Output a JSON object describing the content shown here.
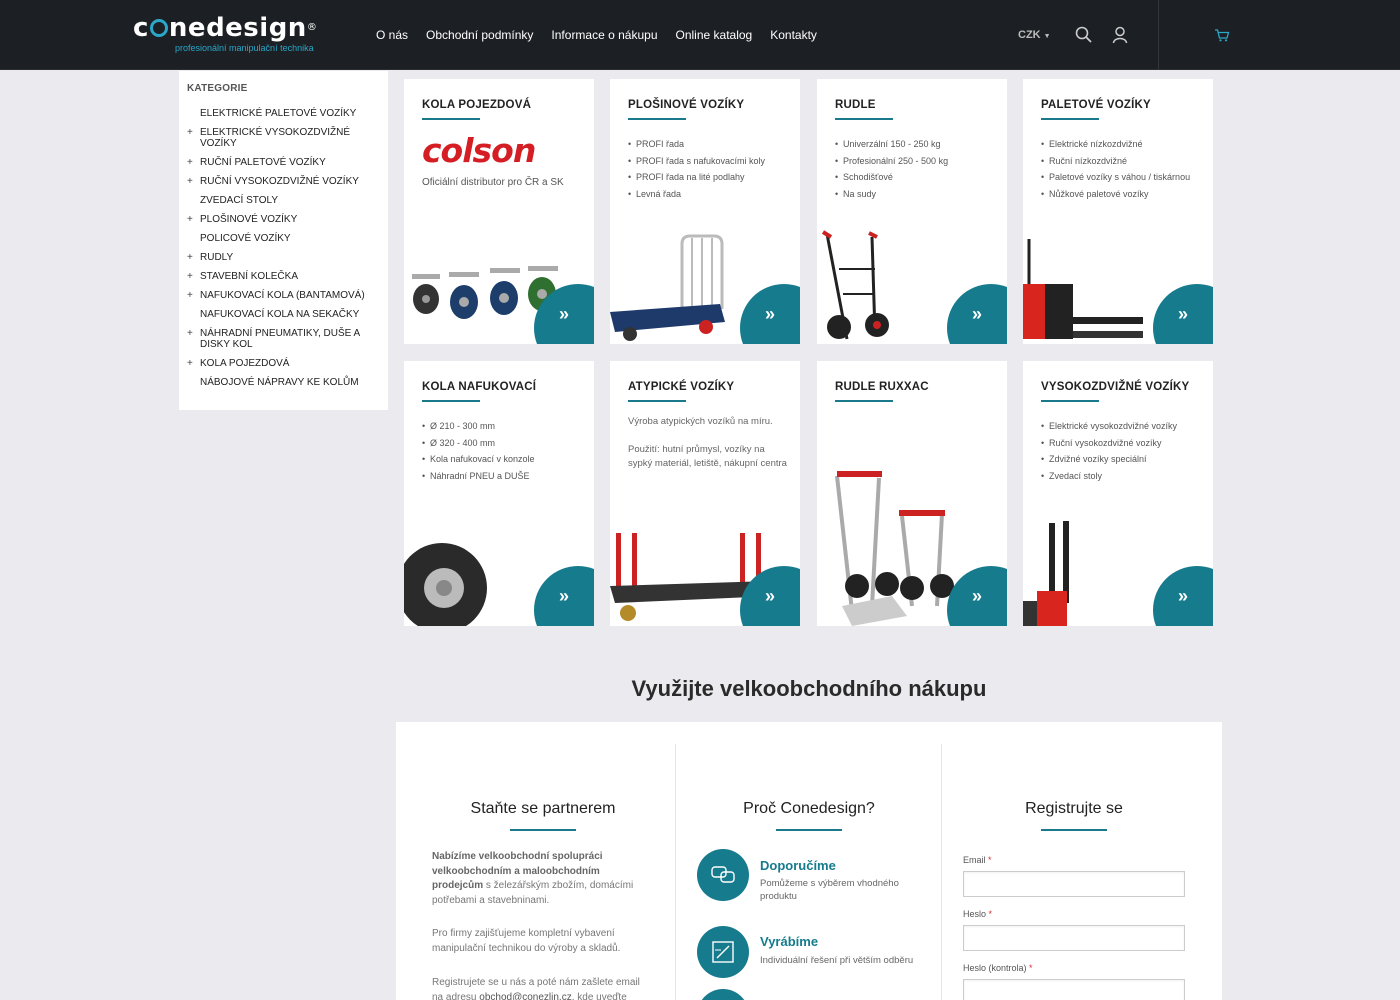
{
  "header": {
    "logo_text": "conedesign",
    "logo_sub": "profesionální manipulační technika",
    "nav": [
      "O nás",
      "Obchodní podmínky",
      "Informace o nákupu",
      "Online katalog",
      "Kontakty"
    ],
    "currency": "CZK",
    "accent": "#2aa7c9"
  },
  "sidebar": {
    "title": "KATEGORIE",
    "items": [
      {
        "label": "ELEKTRICKÉ PALETOVÉ VOZÍKY",
        "plus": ""
      },
      {
        "label": "ELEKTRICKÉ VYSOKOZDVIŽNÉ VOZÍKY",
        "plus": "+"
      },
      {
        "label": "RUČNÍ PALETOVÉ VOZÍKY",
        "plus": "+"
      },
      {
        "label": "RUČNÍ VYSOKOZDVIŽNÉ VOZÍKY",
        "plus": "+"
      },
      {
        "label": "ZVEDACÍ STOLY",
        "plus": ""
      },
      {
        "label": "PLOŠINOVÉ VOZÍKY",
        "plus": "+"
      },
      {
        "label": "POLICOVÉ VOZÍKY",
        "plus": ""
      },
      {
        "label": "RUDLY",
        "plus": "+"
      },
      {
        "label": "STAVEBNÍ KOLEČKA",
        "plus": "+"
      },
      {
        "label": "NAFUKOVACÍ KOLA (BANTAMOVÁ)",
        "plus": "+"
      },
      {
        "label": "NAFUKOVACÍ KOLA NA SEKAČKY",
        "plus": ""
      },
      {
        "label": "NÁHRADNÍ PNEUMATIKY, DUŠE A DISKY KOL",
        "plus": "+"
      },
      {
        "label": "KOLA POJEZDOVÁ",
        "plus": "+"
      },
      {
        "label": "NÁBOJOVÉ NÁPRAVY KE KOLŮM",
        "plus": ""
      }
    ]
  },
  "cards": {
    "c1": {
      "title": "KOLA POJEZDOVÁ",
      "brand": "colson",
      "brand_sub": "Oficiální distributor pro ČR a SK"
    },
    "c2": {
      "title": "PLOŠINOVÉ VOZÍKY",
      "items": [
        "PROFI řada",
        "PROFI řada s nafukovacími koly",
        "PROFI řada na lité podlahy",
        "Levná řada"
      ]
    },
    "c3": {
      "title": "RUDLE",
      "items": [
        "Univerzální 150 - 250 kg",
        "Profesionální 250 - 500 kg",
        "Schodišťové",
        "Na sudy"
      ]
    },
    "c4": {
      "title": "PALETOVÉ VOZÍKY",
      "items": [
        "Elektrické nízkozdvižné",
        "Ruční nízkozdvižné",
        "Paletové vozíky s váhou / tiskárnou",
        "Nůžkové paletové vozíky"
      ]
    },
    "c5": {
      "title": "KOLA NAFUKOVACÍ",
      "items": [
        "Ø 210 - 300 mm",
        "Ø 320 - 400 mm",
        "Kola nafukovací v konzole",
        "Náhradní PNEU a DUŠE"
      ]
    },
    "c6": {
      "title": "ATYPICKÉ VOZÍKY",
      "desc1": "Výroba atypických vozíků na míru.",
      "desc2": "Použití: hutní průmysl, vozíky na sypký materiál, letiště, nákupní centra"
    },
    "c7": {
      "title": "RUDLE RUXXAC"
    },
    "c8": {
      "title": "VYSOKOZDVIŽNÉ VOZÍKY",
      "items": [
        "Elektrické vysokozdvižné vozíky",
        "Ruční vysokozdvižné vozíky",
        "Zdvižné vozíky speciální",
        "Zvedací stoly"
      ]
    },
    "arrow_glyph": "»",
    "accent": "#157b8d"
  },
  "wholesale": {
    "title": "Využijte velkoobchodního nákupu",
    "partner": {
      "title": "Staňte se partnerem",
      "p1_bold": "Nabízíme velkoobchodní spolupráci velkoobchodním a maloobchodním prodejcům",
      "p1_rest": " s železářským zbožím, domácími potřebami a stavebninami.",
      "p2": "Pro firmy zajišťujeme kompletní vybavení manipulační technikou do výroby a skladů.",
      "p3_a": "Registrujete se u nás a poté nám zašlete email na adresu ",
      "p3_link": "obchod@conezlin.cz",
      "p3_b": ", kde uveďte své"
    },
    "why": {
      "title": "Proč Conedesign?",
      "f1_title": "Doporučíme",
      "f1_desc": "Pomůžeme s výběrem vhodného produktu",
      "f2_title": "Vyrábíme",
      "f2_desc": "Individuální řešení při větším odběru"
    },
    "register": {
      "title": "Registrujte se",
      "email_label": "Email",
      "password_label": "Heslo",
      "password2_label": "Heslo (kontrola)",
      "required_mark": "*"
    }
  }
}
